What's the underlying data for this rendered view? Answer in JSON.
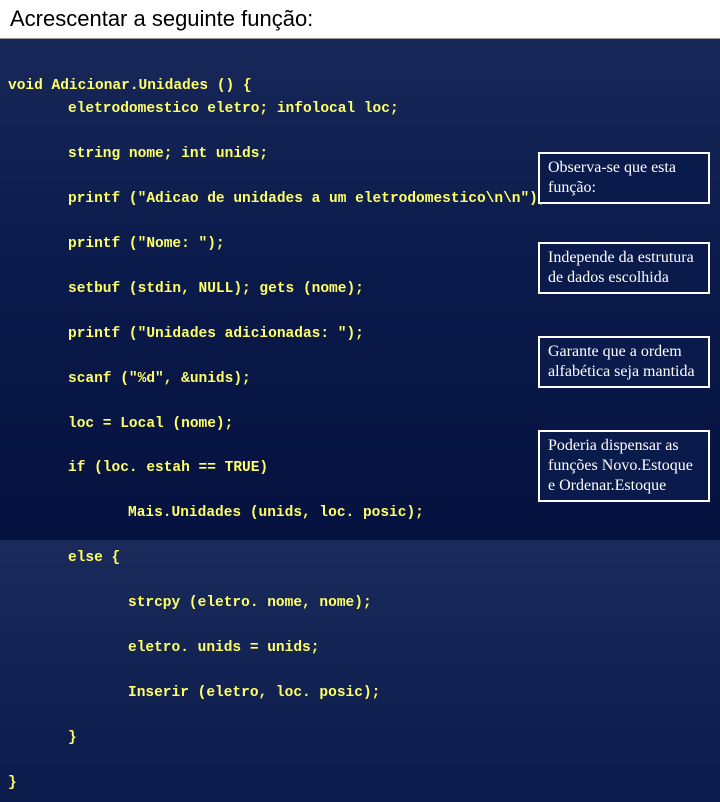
{
  "title": "Acrescentar a seguinte função:",
  "code": {
    "l0": "void Adicionar.Unidades () {",
    "l1": "eletrodomestico eletro; infolocal loc;",
    "l2": "string nome; int unids;",
    "l3": "printf (\"Adicao de unidades a um eletrodomestico\\n\\n\");",
    "l4": "printf (\"Nome: \");",
    "l5": "setbuf (stdin, NULL); gets (nome);",
    "l6": "printf (\"Unidades adicionadas: \");",
    "l7": "scanf (\"%d\", &unids);",
    "l8": "loc = Local (nome);",
    "l9": "if (loc. estah == TRUE)",
    "l10": "Mais.Unidades (unids, loc. posic);",
    "l11": "else {",
    "l12": "strcpy (eletro. nome, nome);",
    "l13": "eletro. unids = unids;",
    "l14": "Inserir (eletro, loc. posic);",
    "l15": "}",
    "l16": "}"
  },
  "callouts": {
    "c1": "Observa-se que esta função:",
    "c2": "Independe da estrutura de dados escolhida",
    "c3": "Garante que a ordem alfabética seja mantida",
    "c4": "Poderia dispensar as funções Novo.Estoque e Ordenar.Estoque"
  }
}
